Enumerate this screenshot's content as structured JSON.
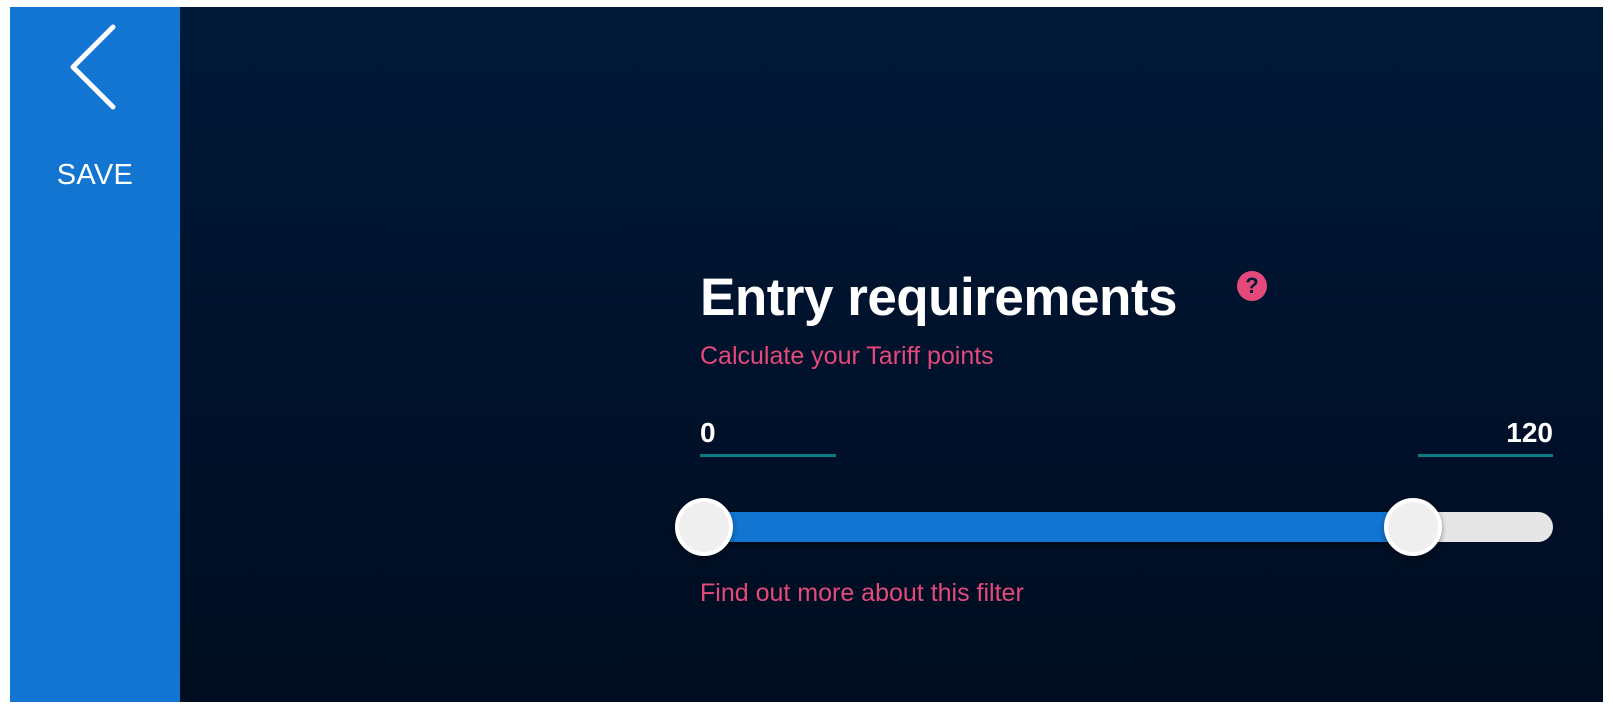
{
  "sidebar": {
    "back_icon": "chevron-left-icon",
    "save_label": "SAVE",
    "background": "#1275d1"
  },
  "filter": {
    "title": "Entry requirements",
    "help_icon": "question-mark-icon",
    "help_glyph": "?",
    "tariff_link": "Calculate your Tariff points",
    "range": {
      "min_value": "0",
      "max_value": "120",
      "lower_fraction": 0,
      "upper_fraction": 0.835
    },
    "more_link": "Find out more about this filter"
  },
  "colors": {
    "accent": "#e5497a",
    "primary": "#1275d1",
    "underline": "#0c7c84",
    "background": "#001a3a"
  }
}
